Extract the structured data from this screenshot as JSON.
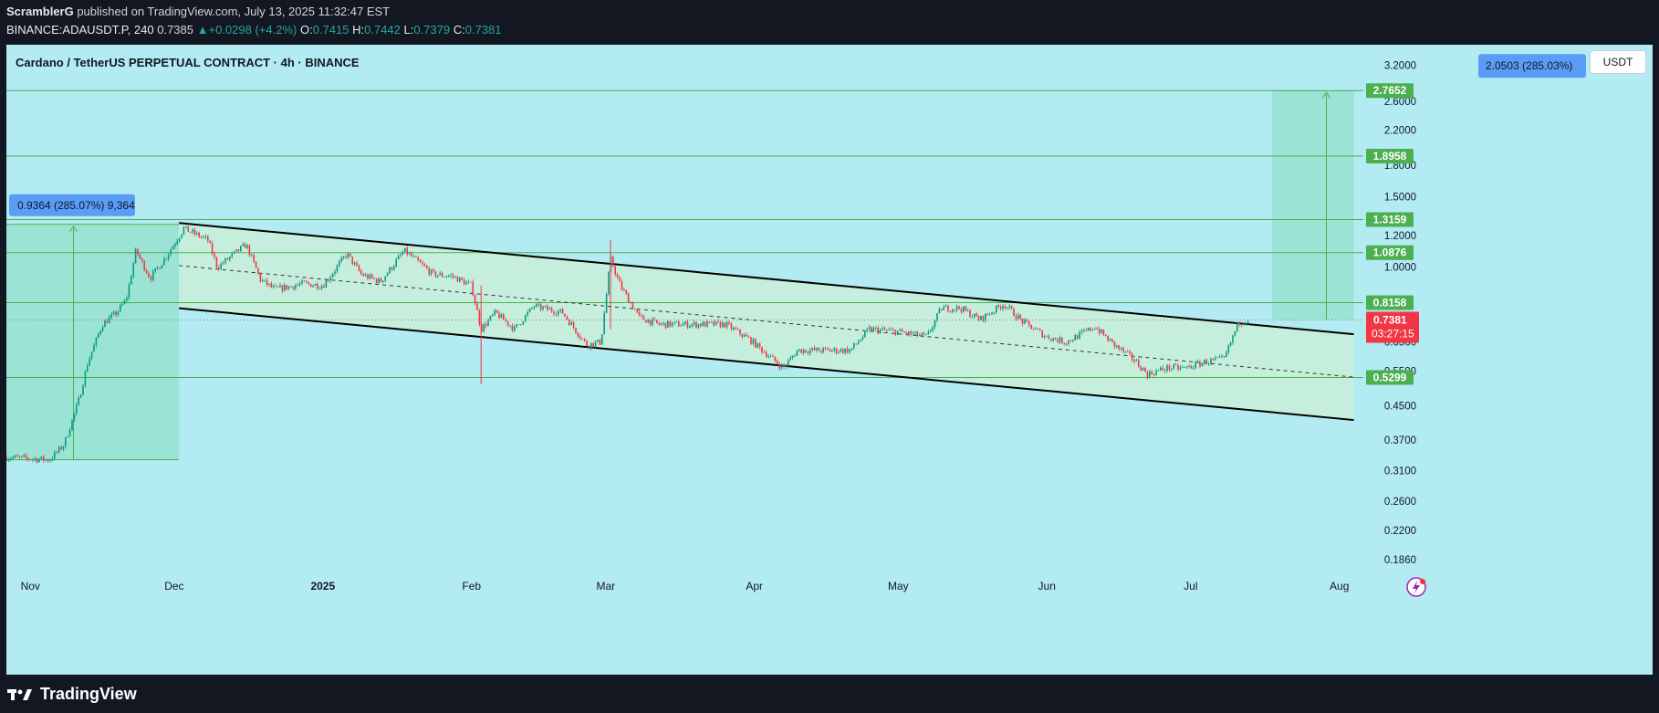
{
  "header": {
    "publisher": "ScramblerG",
    "published_text": "published on TradingView.com, July 13, 2025 11:32:47 EST",
    "symbol": "BINANCE:ADAUSDT.P, 240",
    "last": "0.7385",
    "change": "+0.0298 (+4.2%)",
    "open_label": "O:",
    "open": "0.7415",
    "high_label": "H:",
    "high": "0.7442",
    "low_label": "L:",
    "low": "0.7379",
    "close_label": "C:",
    "close": "0.7381"
  },
  "chart_title": "Cardano / TetherUS PERPETUAL CONTRACT · 4h · BINANCE",
  "currency_button": "USDT",
  "footer": {
    "logo_text": "TradingView",
    "logo_icon": "tradingview-logo-icon"
  },
  "colors": {
    "background": "#b2ebf2",
    "candle_up": "#089981",
    "candle_down": "#f23645",
    "channel_fill": "#c8f0d8",
    "level_line": "#4caf50",
    "level_label": "#4caf50",
    "price_label": "#f23645",
    "measure_label": "#5b9cf6"
  },
  "chart_data": {
    "type": "candlestick",
    "x_range": [
      "2024-10-27",
      "2025-08-06"
    ],
    "y_scale": "log",
    "ylim": [
      0.18,
      3.6
    ],
    "x_ticks": [
      {
        "label": "Nov",
        "date": "2024-11-01"
      },
      {
        "label": "Dec",
        "date": "2024-12-01"
      },
      {
        "label": "2025",
        "date": "2025-01-01"
      },
      {
        "label": "Feb",
        "date": "2025-02-01"
      },
      {
        "label": "Mar",
        "date": "2025-03-01"
      },
      {
        "label": "Apr",
        "date": "2025-04-01"
      },
      {
        "label": "May",
        "date": "2025-05-01"
      },
      {
        "label": "Jun",
        "date": "2025-06-01"
      },
      {
        "label": "Jul",
        "date": "2025-07-01"
      },
      {
        "label": "Aug",
        "date": "2025-08-01"
      }
    ],
    "y_ticks": [
      "3.2000",
      "2.6000",
      "2.2000",
      "1.8000",
      "1.5000",
      "1.2000",
      "1.0000",
      "0.6500",
      "0.5500",
      "0.4500",
      "0.3700",
      "0.3100",
      "0.2600",
      "0.2200",
      "0.1860"
    ],
    "levels": [
      {
        "value": 2.7652,
        "label": "2.7652"
      },
      {
        "value": 1.8958,
        "label": "1.8958"
      },
      {
        "value": 1.3159,
        "label": "1.3159"
      },
      {
        "value": 1.0876,
        "label": "1.0876"
      },
      {
        "value": 0.8158,
        "label": "0.8158"
      },
      {
        "value": 0.5299,
        "label": "0.5299"
      }
    ],
    "current_price": {
      "value": 0.7381,
      "label": "0.7381",
      "countdown": "03:27:15"
    },
    "measure_left": {
      "from_date": "2024-11-10",
      "to_date": "2024-12-02",
      "from": 0.33,
      "to": 1.28,
      "label": "0.9364 (285.07%) 9,364"
    },
    "measure_right": {
      "from_date": "2025-07-18",
      "to_date": "2025-08-04",
      "from": 0.7381,
      "to": 2.7652,
      "label": "2.0503 (285.03%)"
    },
    "channel": {
      "upper": [
        {
          "date": "2024-12-02",
          "value": 1.29
        },
        {
          "date": "2025-08-04",
          "value": 0.68
        }
      ],
      "lower": [
        {
          "date": "2024-12-02",
          "value": 0.79
        },
        {
          "date": "2025-08-04",
          "value": 0.415
        }
      ],
      "mid": [
        {
          "date": "2024-12-02",
          "value": 1.01
        },
        {
          "date": "2025-08-04",
          "value": 0.531
        }
      ]
    },
    "price_path": [
      {
        "date": "2024-10-27",
        "value": 0.335
      },
      {
        "date": "2024-11-05",
        "value": 0.33
      },
      {
        "date": "2024-11-08",
        "value": 0.36
      },
      {
        "date": "2024-11-11",
        "value": 0.46
      },
      {
        "date": "2024-11-13",
        "value": 0.58
      },
      {
        "date": "2024-11-16",
        "value": 0.72
      },
      {
        "date": "2024-11-19",
        "value": 0.77
      },
      {
        "date": "2024-11-21",
        "value": 0.83
      },
      {
        "date": "2024-11-23",
        "value": 1.1
      },
      {
        "date": "2024-11-26",
        "value": 0.94
      },
      {
        "date": "2024-11-29",
        "value": 1.05
      },
      {
        "date": "2024-12-03",
        "value": 1.25
      },
      {
        "date": "2024-12-08",
        "value": 1.17
      },
      {
        "date": "2024-12-10",
        "value": 1.0
      },
      {
        "date": "2024-12-16",
        "value": 1.14
      },
      {
        "date": "2024-12-19",
        "value": 0.93
      },
      {
        "date": "2024-12-22",
        "value": 0.88
      },
      {
        "date": "2024-12-28",
        "value": 0.91
      },
      {
        "date": "2025-01-01",
        "value": 0.9
      },
      {
        "date": "2025-01-06",
        "value": 1.08
      },
      {
        "date": "2025-01-09",
        "value": 0.96
      },
      {
        "date": "2025-01-13",
        "value": 0.92
      },
      {
        "date": "2025-01-18",
        "value": 1.1
      },
      {
        "date": "2025-01-24",
        "value": 0.96
      },
      {
        "date": "2025-01-28",
        "value": 0.95
      },
      {
        "date": "2025-02-01",
        "value": 0.9
      },
      {
        "date": "2025-02-03",
        "value": 0.7
      },
      {
        "date": "2025-02-06",
        "value": 0.77
      },
      {
        "date": "2025-02-10",
        "value": 0.7
      },
      {
        "date": "2025-02-14",
        "value": 0.8
      },
      {
        "date": "2025-02-20",
        "value": 0.77
      },
      {
        "date": "2025-02-25",
        "value": 0.64
      },
      {
        "date": "2025-02-28",
        "value": 0.65
      },
      {
        "date": "2025-03-02",
        "value": 1.05
      },
      {
        "date": "2025-03-04",
        "value": 0.9
      },
      {
        "date": "2025-03-08",
        "value": 0.75
      },
      {
        "date": "2025-03-12",
        "value": 0.72
      },
      {
        "date": "2025-03-20",
        "value": 0.72
      },
      {
        "date": "2025-03-26",
        "value": 0.72
      },
      {
        "date": "2025-03-31",
        "value": 0.66
      },
      {
        "date": "2025-04-07",
        "value": 0.56
      },
      {
        "date": "2025-04-10",
        "value": 0.62
      },
      {
        "date": "2025-04-15",
        "value": 0.62
      },
      {
        "date": "2025-04-21",
        "value": 0.62
      },
      {
        "date": "2025-04-25",
        "value": 0.7
      },
      {
        "date": "2025-05-01",
        "value": 0.69
      },
      {
        "date": "2025-05-07",
        "value": 0.67
      },
      {
        "date": "2025-05-10",
        "value": 0.79
      },
      {
        "date": "2025-05-14",
        "value": 0.79
      },
      {
        "date": "2025-05-18",
        "value": 0.74
      },
      {
        "date": "2025-05-23",
        "value": 0.81
      },
      {
        "date": "2025-05-27",
        "value": 0.73
      },
      {
        "date": "2025-06-01",
        "value": 0.67
      },
      {
        "date": "2025-06-05",
        "value": 0.65
      },
      {
        "date": "2025-06-11",
        "value": 0.71
      },
      {
        "date": "2025-06-15",
        "value": 0.64
      },
      {
        "date": "2025-06-19",
        "value": 0.59
      },
      {
        "date": "2025-06-22",
        "value": 0.54
      },
      {
        "date": "2025-06-26",
        "value": 0.56
      },
      {
        "date": "2025-06-30",
        "value": 0.56
      },
      {
        "date": "2025-07-04",
        "value": 0.58
      },
      {
        "date": "2025-07-08",
        "value": 0.59
      },
      {
        "date": "2025-07-11",
        "value": 0.73
      },
      {
        "date": "2025-07-13",
        "value": 0.7381
      }
    ]
  }
}
